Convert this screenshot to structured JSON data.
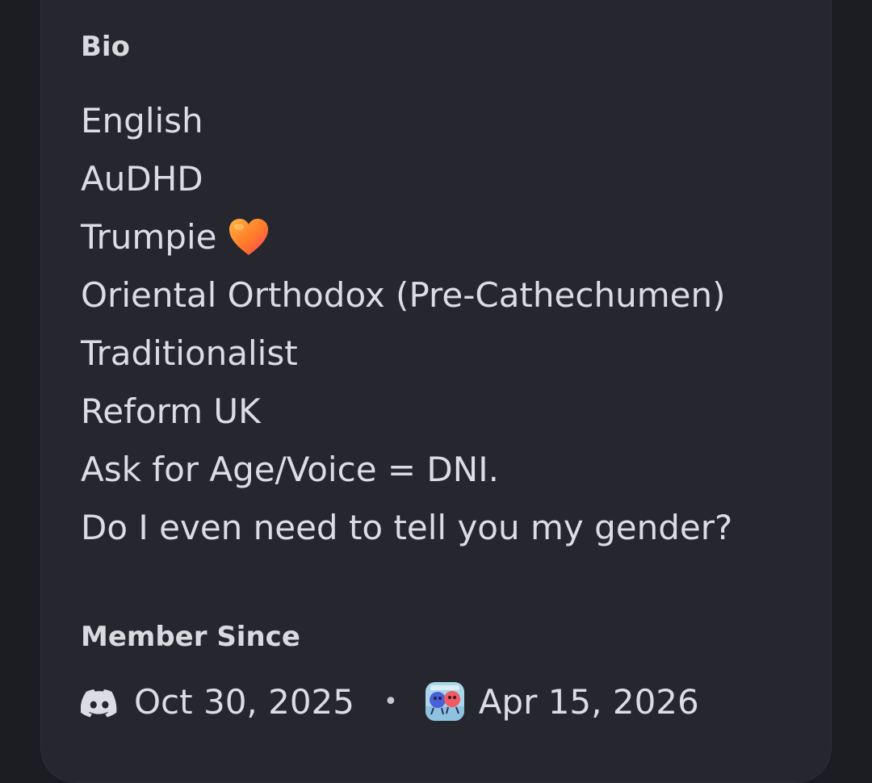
{
  "bio": {
    "title": "Bio",
    "lines": [
      "English",
      "AuDHD",
      "Trumpie",
      "Oriental Orthodox (Pre-Cathechumen)",
      "Traditionalist",
      "Reform UK",
      "Ask for Age/Voice = DNI.",
      "Do I even need to tell you my gender?"
    ],
    "emoji": "orange-heart-icon"
  },
  "member_since": {
    "title": "Member Since",
    "discord_date": "Oct 30, 2025",
    "separator": "•",
    "server_date": "Apr 15, 2026",
    "discord_icon": "discord-logo-icon",
    "server_icon": "server-avatar-icon"
  },
  "colors": {
    "background": "#1c1d22",
    "card": "#25262e",
    "text": "#dcdde2",
    "heading": "#d9dade"
  }
}
